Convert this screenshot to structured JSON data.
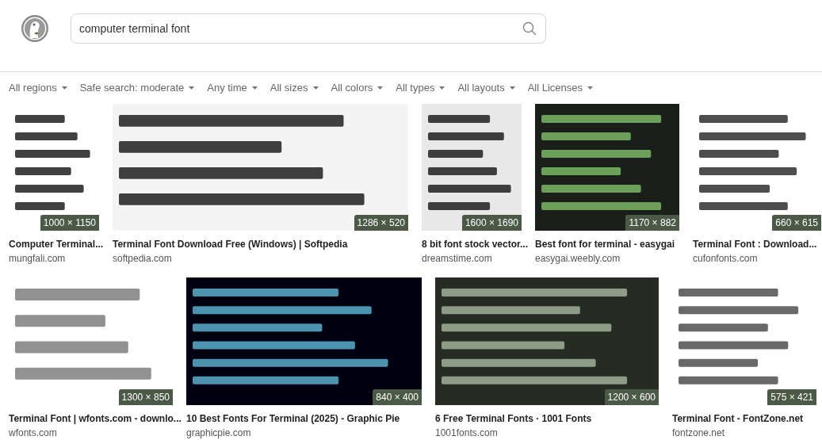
{
  "search": {
    "value": "computer terminal font"
  },
  "filters": [
    {
      "label": "All regions"
    },
    {
      "label": "Safe search: moderate"
    },
    {
      "label": "Any time"
    },
    {
      "label": "All sizes"
    },
    {
      "label": "All colors"
    },
    {
      "label": "All types"
    },
    {
      "label": "All layouts"
    },
    {
      "label": "All Licenses"
    }
  ],
  "result_rows": [
    {
      "results": [
        {
          "title": "Computer Terminal...",
          "source": "mungfali.com",
          "size": "1000 × 1150"
        },
        {
          "title": "Terminal Font Download Free (Windows) | Softpedia",
          "source": "softpedia.com",
          "size": "1286 × 520"
        },
        {
          "title": "8 bit font stock vector...",
          "source": "dreamstime.com",
          "size": "1600 × 1690"
        },
        {
          "title": "Best font for terminal - easygai",
          "source": "easygai.weebly.com",
          "size": "1170 × 882"
        },
        {
          "title": "Terminal Font : Download...",
          "source": "cufonfonts.com",
          "size": "660 × 615"
        }
      ]
    },
    {
      "results": [
        {
          "title": "Terminal Font | wfonts.com - downlo...",
          "source": "wfonts.com",
          "size": "1300 × 850"
        },
        {
          "title": "10 Best Fonts For Terminal (2025) - Graphic Pie",
          "source": "graphicpie.com",
          "size": "840 × 400"
        },
        {
          "title": "6 Free Terminal Fonts · 1001 Fonts",
          "source": "1001fonts.com",
          "size": "1200 × 600"
        },
        {
          "title": "Terminal Font - FontZone.net",
          "source": "fontzone.net",
          "size": "575 × 421"
        }
      ]
    }
  ]
}
